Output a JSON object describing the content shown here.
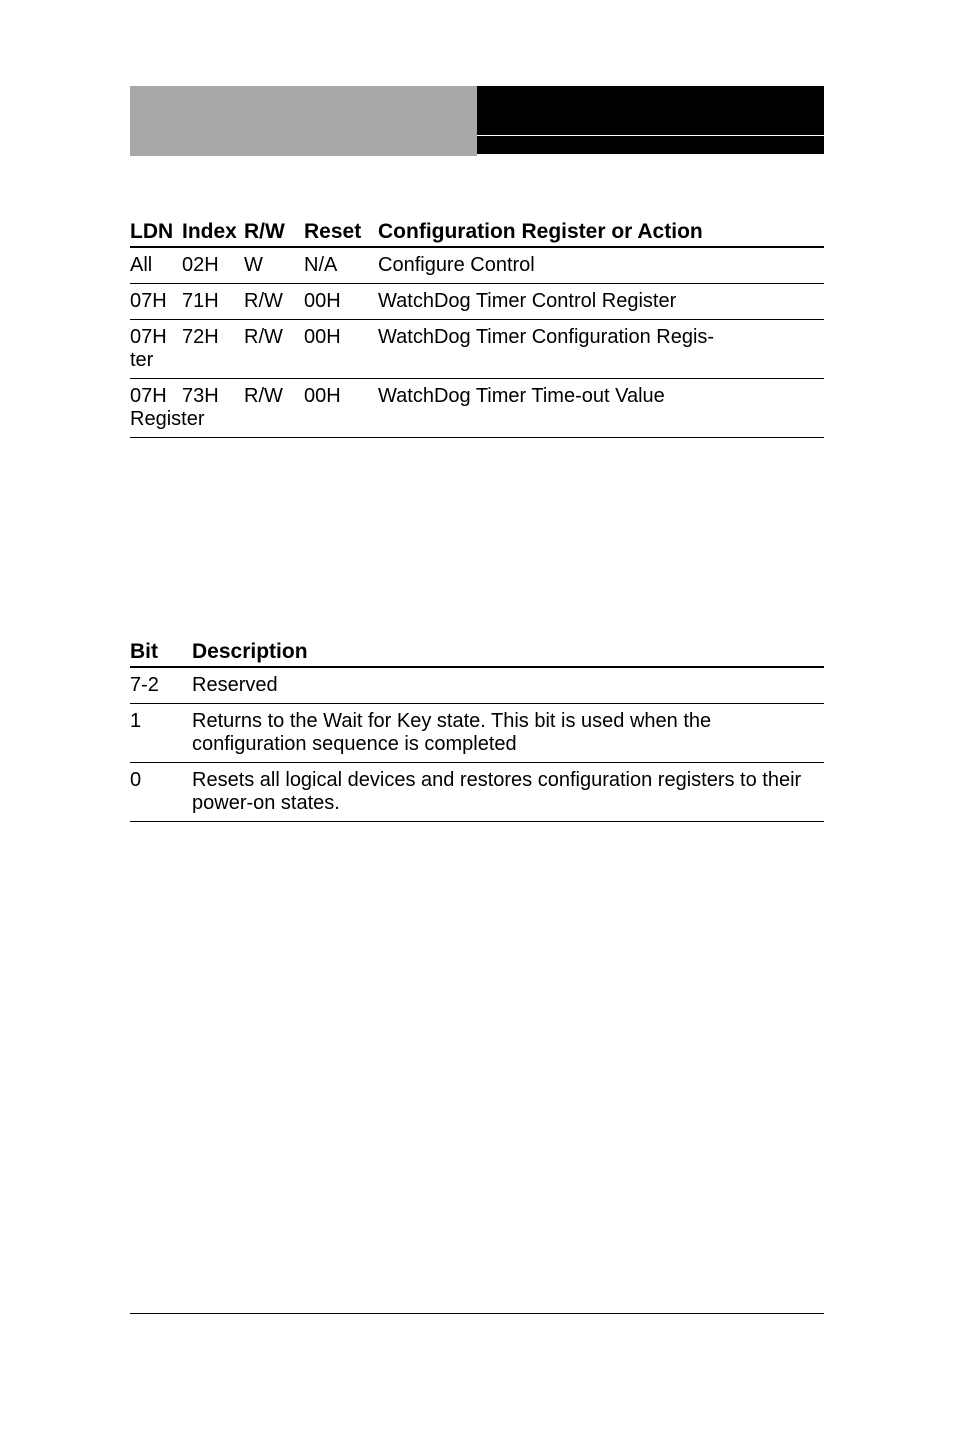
{
  "header": {
    "left": "",
    "right": ""
  },
  "table1": {
    "headers": {
      "ldn": "LDN",
      "index": "Index",
      "rw": "R/W",
      "reset": "Reset",
      "config": "Configuration Register or Action"
    },
    "rows": [
      {
        "ldn": "All",
        "index": "02H",
        "rw": "W",
        "reset": "N/A",
        "config": "Configure Control",
        "suffix": ""
      },
      {
        "ldn": "07H",
        "index": "71H",
        "rw": "R/W",
        "reset": "00H",
        "config": "WatchDog Timer Control Register",
        "suffix": ""
      },
      {
        "ldn": "07H",
        "index": "72H",
        "rw": "R/W",
        "reset": "00H",
        "config": "WatchDog Timer Configuration Regis-",
        "suffix": "ter"
      },
      {
        "ldn": "07H",
        "index": "73H",
        "rw": "R/W",
        "reset": "00H",
        "config": "WatchDog Timer Time-out Value",
        "suffix": "Register"
      }
    ]
  },
  "table2": {
    "headers": {
      "bit": "Bit",
      "desc": "Description"
    },
    "rows": [
      {
        "bit": "7-2",
        "desc": "Reserved"
      },
      {
        "bit": "1",
        "desc": "Returns to the Wait for Key state. This bit is used when the configuration sequence is completed"
      },
      {
        "bit": "0",
        "desc": "Resets all logical devices and restores configuration registers to their power-on states."
      }
    ]
  }
}
